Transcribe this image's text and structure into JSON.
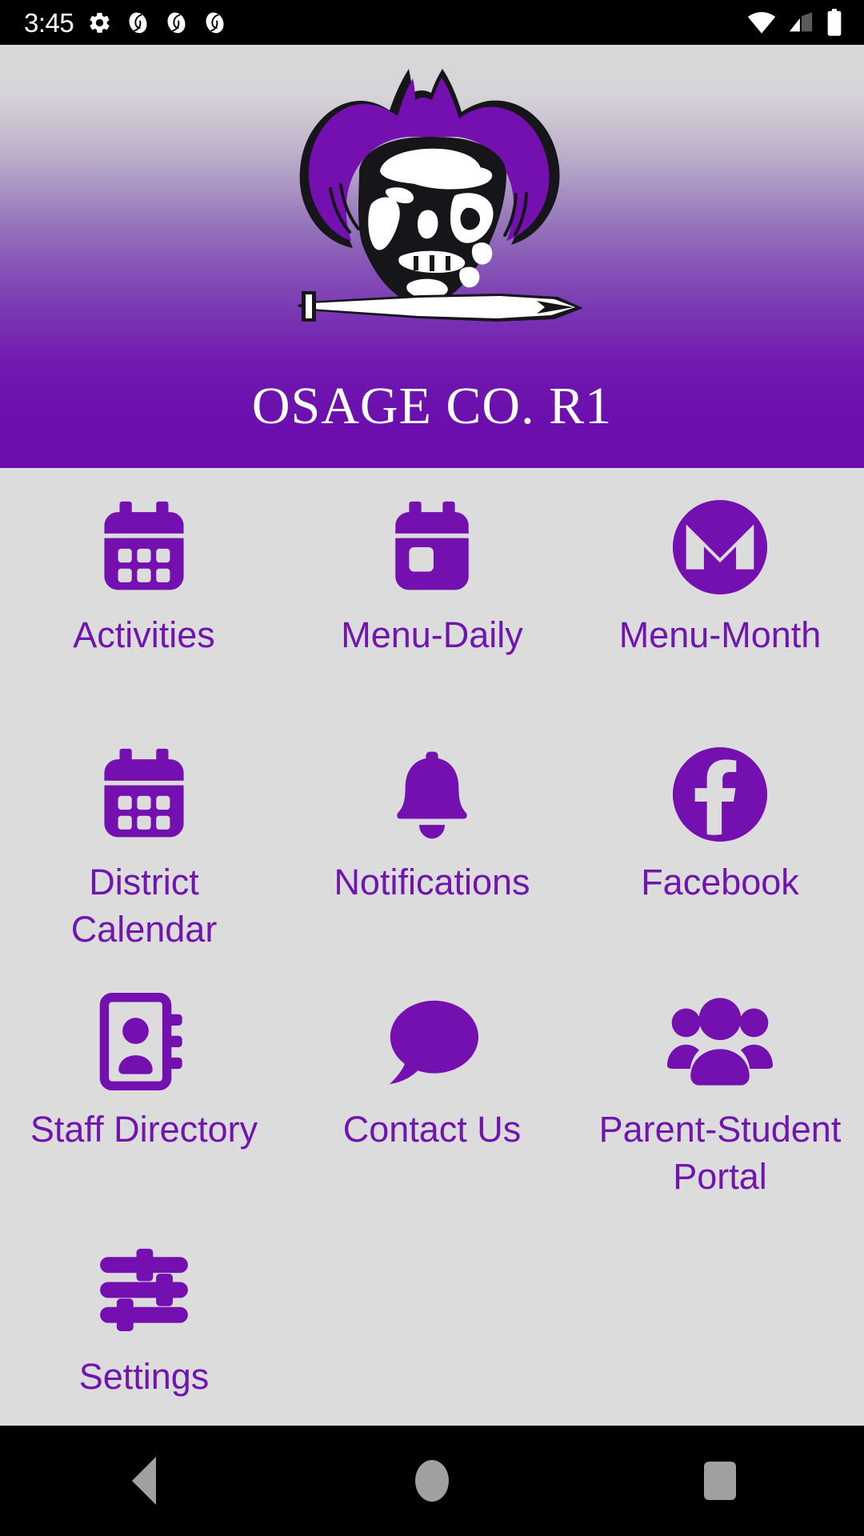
{
  "status_bar": {
    "time": "3:45",
    "left_icons": [
      "gear-icon",
      "app-notification-icon",
      "app-notification-icon",
      "app-notification-icon"
    ],
    "right_icons": [
      "wifi-icon",
      "cellular-signal-icon",
      "battery-icon"
    ]
  },
  "header": {
    "title": "OSAGE CO. R1",
    "logo_name": "pirate-mascot-logo",
    "gradient_top_color": "#D9D9D9",
    "gradient_bottom_color": "#6A0DAD"
  },
  "theme": {
    "accent_purple": "#6A0DAD",
    "label_purple": "#7016AE",
    "page_background": "#DCDCDC",
    "status_bar_background": "#000000",
    "nav_bar_background": "#000000",
    "nav_icon_color": "#A0A0A0"
  },
  "grid": {
    "tiles": [
      {
        "label": "Activities",
        "icon": "calendar-grid-icon"
      },
      {
        "label": "Menu-Daily",
        "icon": "calendar-day-icon"
      },
      {
        "label": "Menu-Month",
        "icon": "monero-m-circle-icon"
      },
      {
        "label": "District\nCalendar",
        "icon": "calendar-grid-icon"
      },
      {
        "label": "Notifications",
        "icon": "bell-icon"
      },
      {
        "label": "Facebook",
        "icon": "facebook-circle-icon"
      },
      {
        "label": "Staff Directory",
        "icon": "address-book-icon"
      },
      {
        "label": "Contact Us",
        "icon": "speech-bubble-icon"
      },
      {
        "label": "Parent-Student\nPortal",
        "icon": "people-group-icon"
      },
      {
        "label": "Settings",
        "icon": "sliders-icon"
      }
    ]
  },
  "nav_bar": {
    "back_label": "Back",
    "home_label": "Home",
    "recents_label": "Recents"
  }
}
